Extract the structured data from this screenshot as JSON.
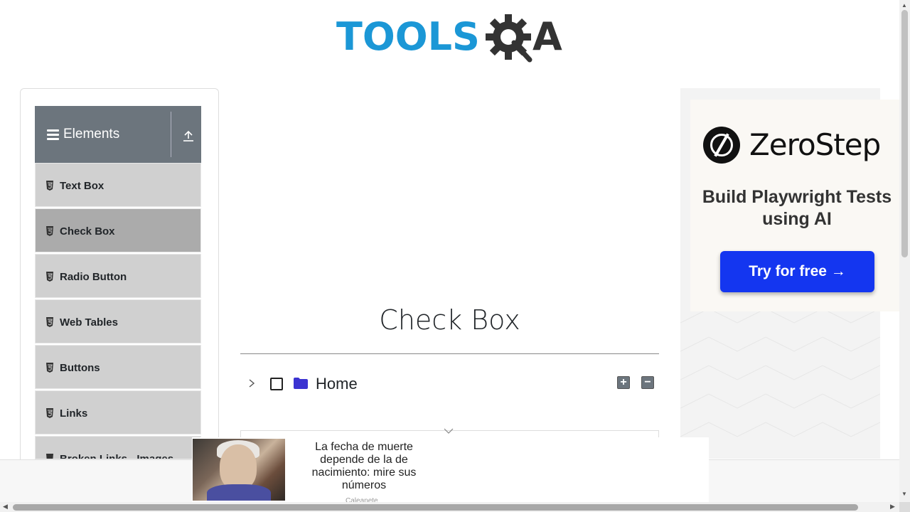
{
  "header": {
    "logo_text": "TOOLS",
    "logo_suffix": "A",
    "colors": {
      "logo_blue": "#1b97d6",
      "logo_dark": "#333333"
    }
  },
  "sidebar": {
    "group_title": "Elements",
    "items": [
      {
        "label": "Text Box",
        "active": false
      },
      {
        "label": "Check Box",
        "active": true
      },
      {
        "label": "Radio Button",
        "active": false
      },
      {
        "label": "Web Tables",
        "active": false
      },
      {
        "label": "Buttons",
        "active": false
      },
      {
        "label": "Links",
        "active": false
      },
      {
        "label": "Broken Links - Images",
        "active": false
      }
    ],
    "colors": {
      "header_bg": "#6c757d",
      "item_bg": "#d0d0d0",
      "active_bg": "#ababab"
    }
  },
  "main": {
    "title": "Check Box",
    "tree": {
      "root_label": "Home",
      "expand_all_symbol": "+",
      "collapse_all_symbol": "−",
      "folder_color": "#3b33d1"
    }
  },
  "ad_right": {
    "brand": "ZeroStep",
    "tagline": "Build Playwright Tests using AI",
    "cta": "Try for free →",
    "colors": {
      "cta_bg": "#1436f0"
    }
  },
  "ad_bottom": {
    "headline": "La fecha de muerte depende de la de nacimiento: mire sus números",
    "source": "Caleanete"
  }
}
